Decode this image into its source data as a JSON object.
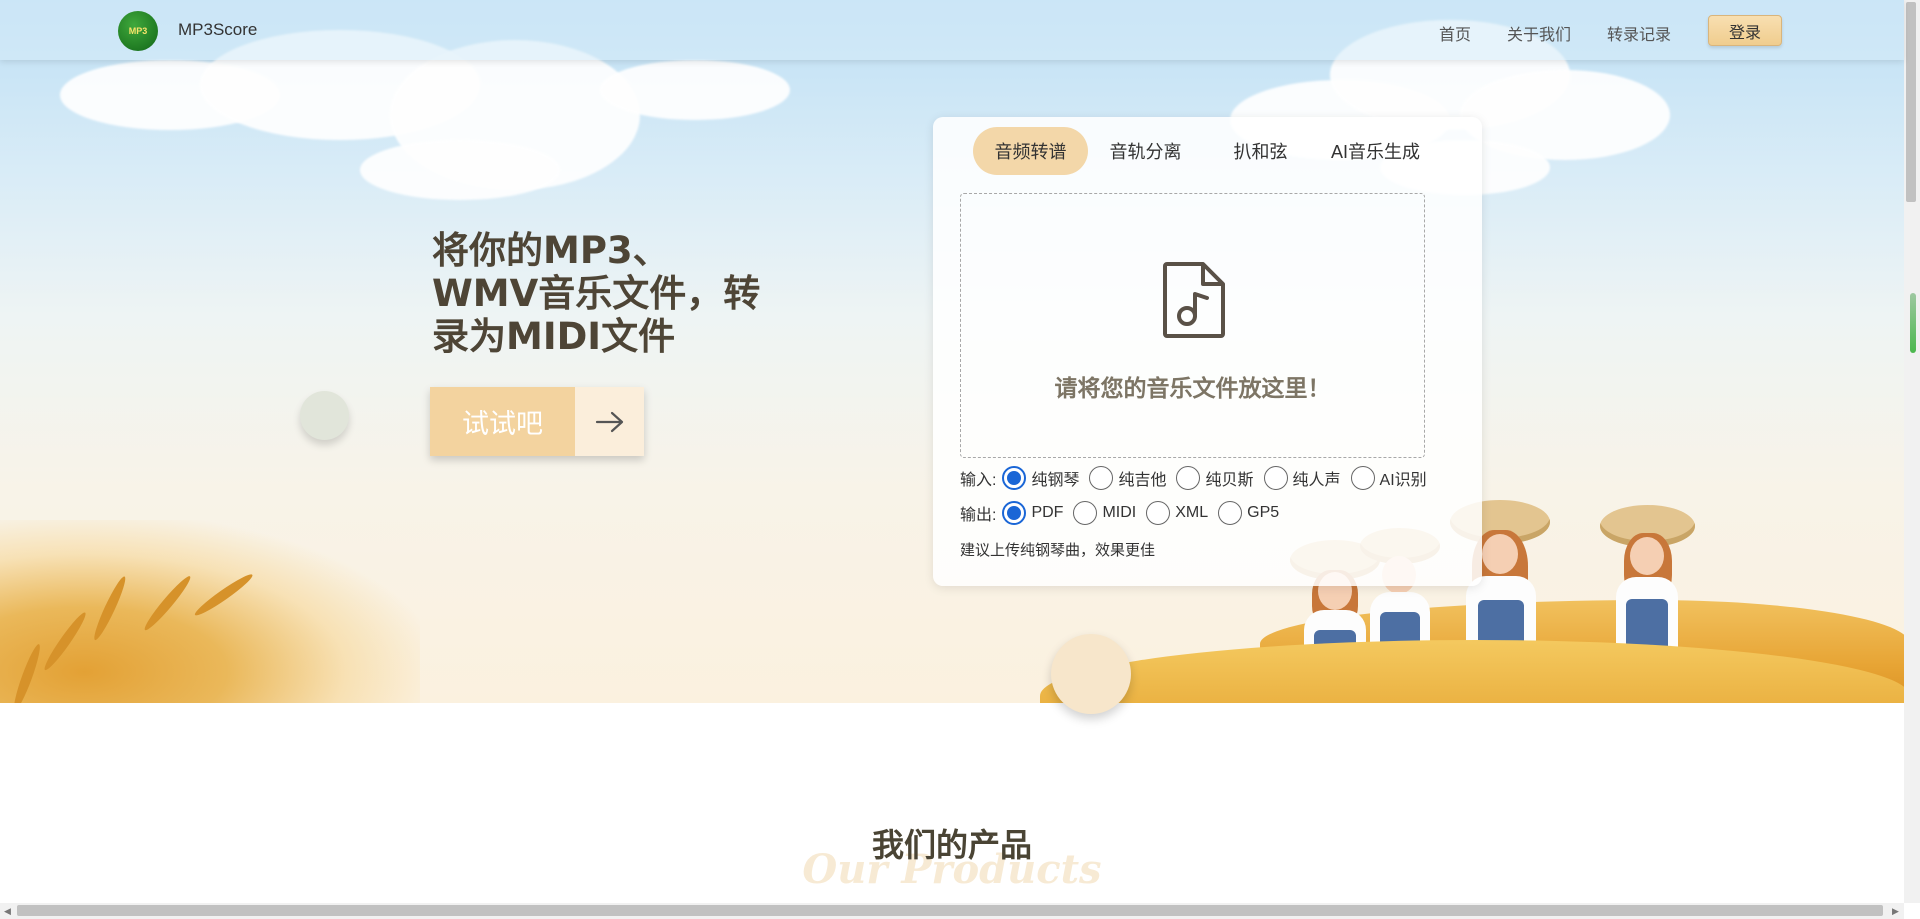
{
  "nav": {
    "brand": "MP3Score",
    "logo_text": "MP3",
    "links": [
      "首页",
      "关于我们",
      "转录记录"
    ],
    "login_label": "登录"
  },
  "hero": {
    "headline": "将你的MP3、WMV音乐文件，转录为MIDI文件",
    "try_label": "试试吧",
    "arrow_icon": "arrow-right-icon"
  },
  "card": {
    "tabs": [
      "音频转谱",
      "音轨分离",
      "扒和弦",
      "AI音乐生成"
    ],
    "active_tab": "音频转谱",
    "dropzone_text": "请将您的音乐文件放这里！",
    "dropzone_icon": "music-file-icon",
    "input_label": "输入:",
    "input_options": [
      "纯钢琴",
      "纯吉他",
      "纯贝斯",
      "纯人声",
      "AI识别"
    ],
    "input_selected": "纯钢琴",
    "output_label": "输出:",
    "output_options": [
      "PDF",
      "MIDI",
      "XML",
      "GP5"
    ],
    "output_selected": "PDF",
    "hint": "建议上传纯钢琴曲，效果更佳"
  },
  "products": {
    "title": "我们的产品",
    "subtitle": "Our Products"
  },
  "colors": {
    "accent": "#f3d7a9",
    "button_light": "#f3d39f",
    "radio_checked": "#1a66d6",
    "heading": "#4e4536"
  }
}
